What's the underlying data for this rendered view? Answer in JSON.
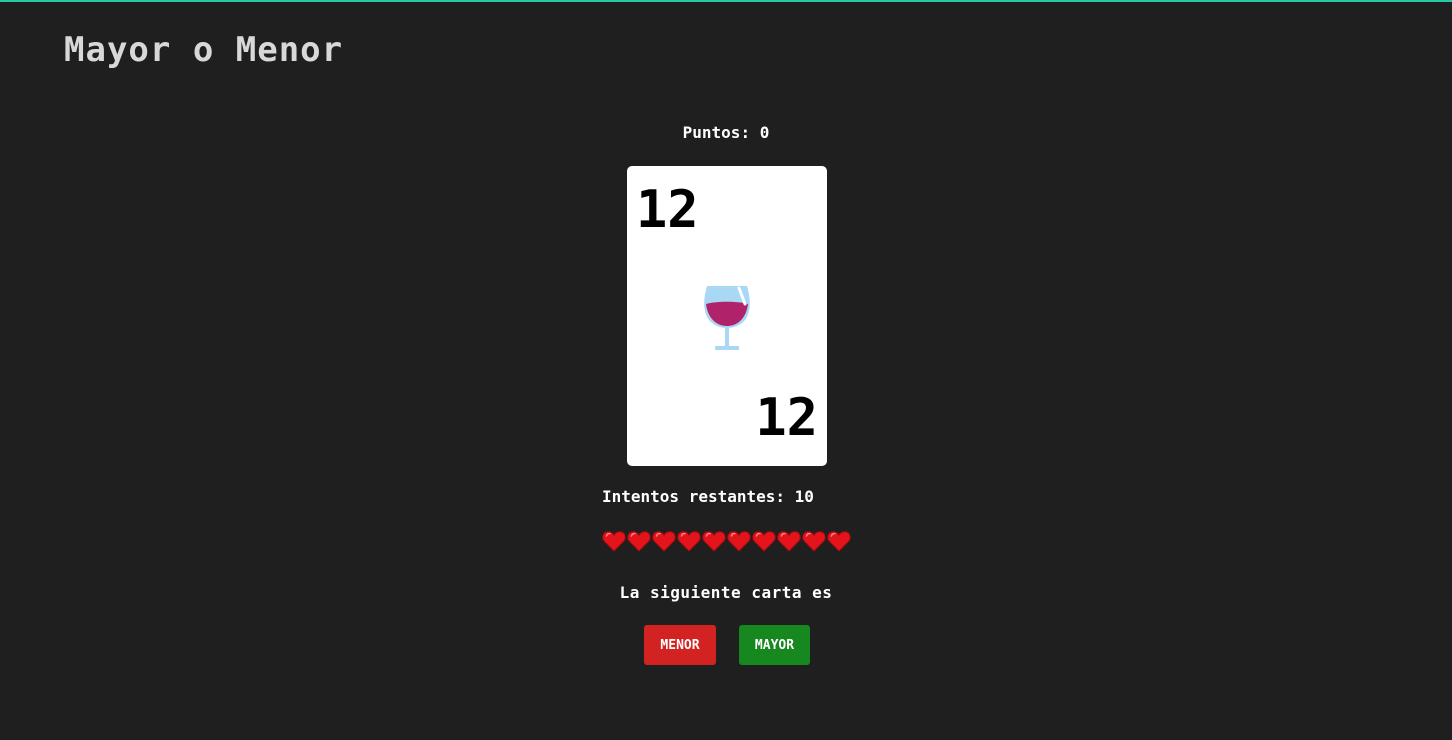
{
  "app": {
    "title": "Mayor o Menor",
    "accent_color": "#27c9a3"
  },
  "game": {
    "score_text": "Puntos: 0",
    "attempts_text": "Intentos restantes: 10",
    "lives": 10,
    "heart_icon": "heart-icon",
    "prompt_text": "La siguiente carta es"
  },
  "card": {
    "rank": "12",
    "suit_icon": "wine-glass-icon"
  },
  "buttons": {
    "lower_label": "MENOR",
    "higher_label": "MAYOR",
    "lower_color": "#d32222",
    "higher_color": "#17871f"
  }
}
